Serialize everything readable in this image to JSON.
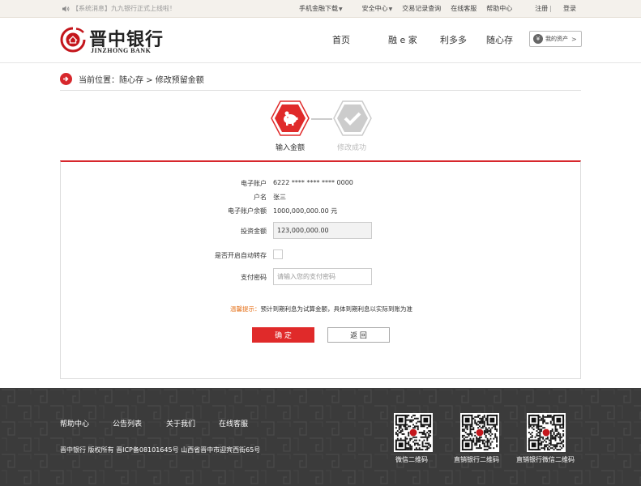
{
  "topbar": {
    "notice": "【系统消息】九九银行正式上线啦！",
    "links": {
      "mobile": "手机金融下载",
      "security": "安全中心",
      "records": "交易记录查询",
      "service": "在线客服",
      "help": "帮助中心",
      "register": "注册",
      "separator": "|",
      "login": "登录"
    }
  },
  "header": {
    "logo_cn": "晋中银行",
    "logo_en": "JINZHONG BANK",
    "nav": [
      "首页",
      "融 e 家",
      "利多多",
      "随心存"
    ],
    "assets_button": "我的资产",
    "assets_currency": "¥"
  },
  "breadcrumb": {
    "text": "当前位置：随心存 > 修改预留金额"
  },
  "steps": [
    {
      "label": "输入金额",
      "state": "active"
    },
    {
      "label": "修改成功",
      "state": "inactive"
    }
  ],
  "form": {
    "account_label": "电子账户",
    "account_value": "6222 **** **** **** 0000",
    "name_label": "户名",
    "name_value": "张三",
    "balance_label": "电子账户余额",
    "balance_value": "1000,000,000.00 元",
    "invest_label": "投资金额",
    "invest_value": "123,000,000.00",
    "auto_label": "是否开启自动转存",
    "auto_checked": false,
    "password_label": "支付密码",
    "password_placeholder": "请输入您的支付密码",
    "tip_highlight": "温馨提示：",
    "tip_text": "预计到期利息为试算金额，具体到期利息以实际到账为准",
    "confirm_button": "确 定",
    "back_button": "返 回"
  },
  "footer": {
    "links": [
      "帮助中心",
      "公告列表",
      "关于我们",
      "在线客服"
    ],
    "copyright": "晋中银行 版权所有 晋ICP备08101645号 山西省晋中市迎宾西街65号",
    "qrcodes": [
      "微信二维码",
      "直销银行二维码",
      "直销银行微信二维码"
    ]
  },
  "colors": {
    "brand_red": "#d7272c",
    "footer_bg": "#3b3b3b",
    "tip_orange": "#e6741e"
  }
}
